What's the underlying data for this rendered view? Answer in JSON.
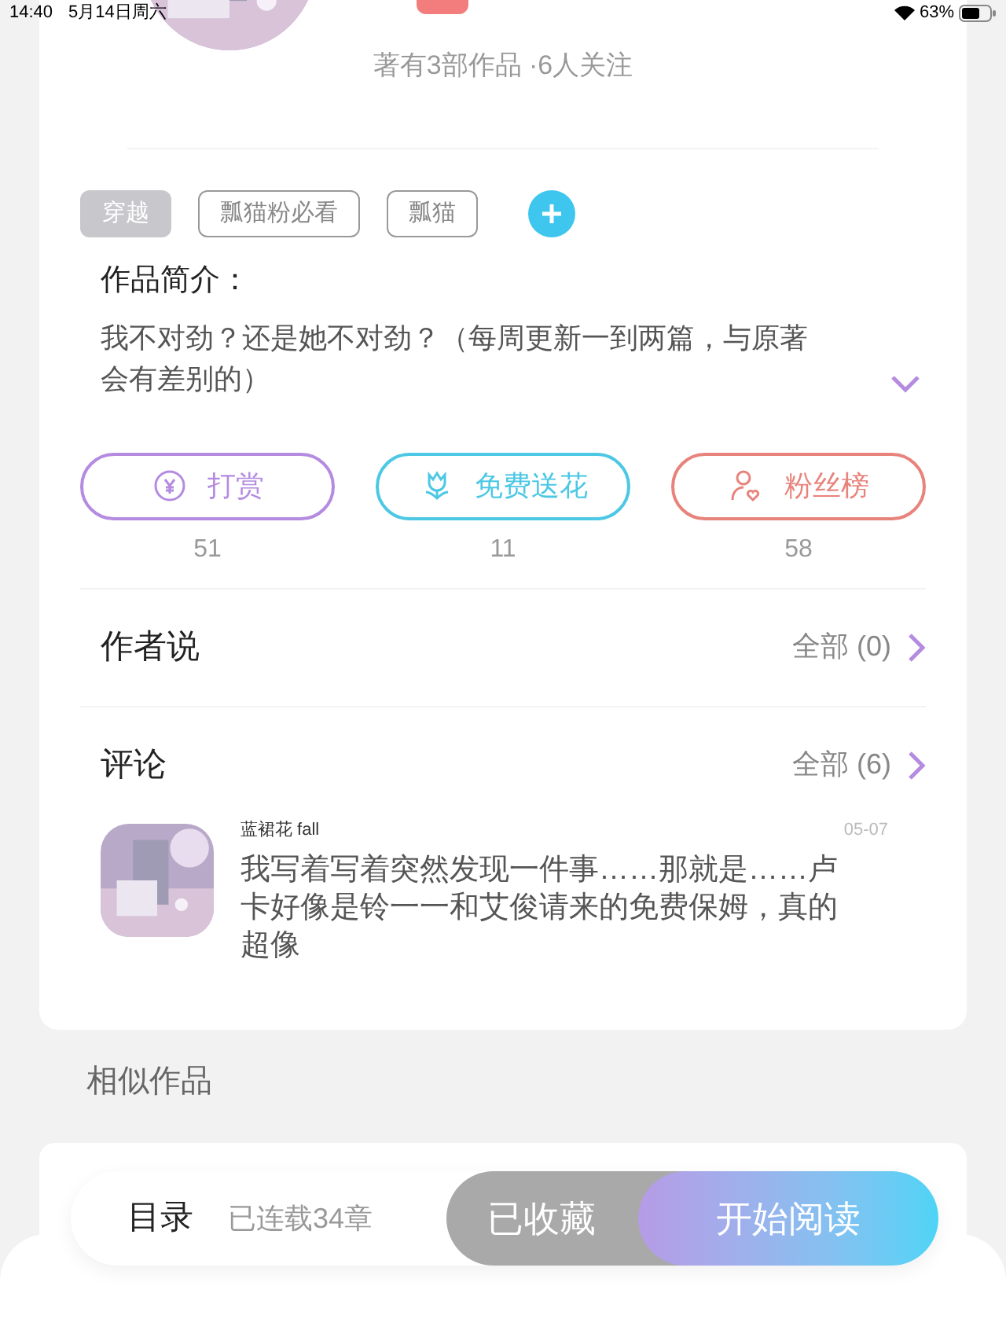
{
  "status_bar": {
    "time": "14:40",
    "date": "5月14日周六",
    "battery": "63%"
  },
  "author": {
    "stats": "著有3部作品 ·6人关注"
  },
  "tags": [
    {
      "label": "穿越",
      "kind": "filled"
    },
    {
      "label": "瓢猫粉必看",
      "kind": "outlined"
    },
    {
      "label": "瓢猫",
      "kind": "outlined"
    }
  ],
  "summary": {
    "heading": "作品简介：",
    "text": "我不对劲？还是她不对劲？（每周更新一到两篇，与原著会有差别的）",
    "expanded": false
  },
  "actions": [
    {
      "label": "打赏",
      "count": "51",
      "color": "#b48be0",
      "kind": "yen"
    },
    {
      "label": "免费送花",
      "count": "11",
      "color": "#4cc8e4",
      "kind": "flower"
    },
    {
      "label": "粉丝榜",
      "count": "58",
      "color": "#e8837c",
      "kind": "fans"
    }
  ],
  "author_notes": {
    "title": "作者说",
    "link": "全部 (0)"
  },
  "comments": {
    "title": "评论",
    "link": "全部 (6)",
    "items": [
      {
        "user": "蓝裙花 fall",
        "date": "05-07",
        "text": "我写着写着突然发现一件事……那就是……卢卡好像是铃一一和艾俊请来的免费保姆，真的超像"
      }
    ]
  },
  "similar": {
    "title": "相似作品"
  },
  "bottom_bar": {
    "catalog": "目录",
    "chapters": "已连载34章",
    "collect": {
      "label": "已收藏",
      "selected": true
    },
    "read": "开始阅读"
  }
}
